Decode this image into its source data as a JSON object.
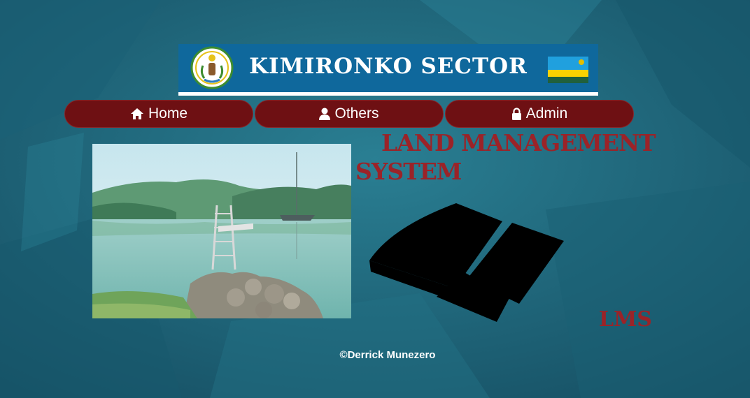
{
  "header": {
    "title": "KIMIRONKO SECTOR",
    "emblem_icon": "rwanda-coat-of-arms-icon",
    "flag_icon": "rwanda-flag-icon"
  },
  "nav": {
    "items": [
      {
        "label": "Home",
        "icon": "home-icon"
      },
      {
        "label": "Others",
        "icon": "user-icon"
      },
      {
        "label": "Admin",
        "icon": "lock-icon"
      }
    ]
  },
  "main": {
    "title_line1": "LAND MANAGEMENT",
    "title_line2": "SYSTEM",
    "abbreviation": "LMS"
  },
  "footer": {
    "copyright": "©Derrick Munezero"
  },
  "colors": {
    "background": "#1d6b80",
    "banner": "#0f689c",
    "nav_button": "#6e1013",
    "title_red": "#9b2328"
  }
}
